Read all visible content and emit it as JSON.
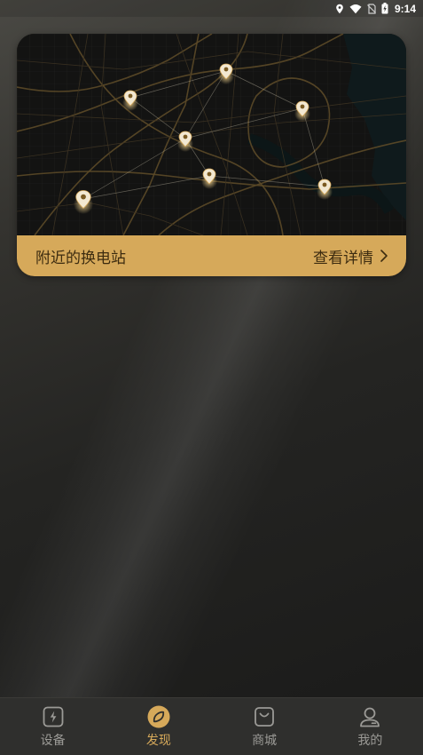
{
  "status_bar": {
    "time": "9:14",
    "icons": [
      "location-icon",
      "wifi-icon",
      "no-sim-icon",
      "battery-charging-icon"
    ]
  },
  "station_card": {
    "title": "附近的换电站",
    "link_label": "查看详情",
    "link_icon": "chevron-right-icon",
    "map_pin_count": 7
  },
  "tab_bar": {
    "active_tab": "discover",
    "tabs": [
      {
        "key": "device",
        "label": "设备",
        "icon": "battery-bolt-icon"
      },
      {
        "key": "discover",
        "label": "发现",
        "icon": "compass-icon"
      },
      {
        "key": "mall",
        "label": "商城",
        "icon": "shopping-bag-icon"
      },
      {
        "key": "mine",
        "label": "我的",
        "icon": "user-profile-icon"
      }
    ]
  },
  "colors": {
    "accent": "#d6a95a",
    "accent_text": "#3d2c10",
    "tab_bar_bg": "#2f2f2d",
    "inactive_tab": "#9b9a96"
  }
}
